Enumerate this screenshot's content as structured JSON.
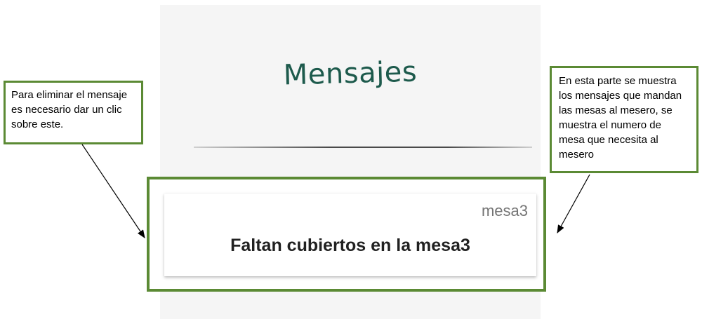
{
  "screen": {
    "title": "Mensajes"
  },
  "message_card": {
    "table": "mesa3",
    "text": "Faltan cubiertos en la mesa3"
  },
  "annotations": {
    "left": "Para eliminar el mensaje es necesario dar un clic sobre este.",
    "right": "En esta parte se muestra los mensajes que mandan las mesas al mesero, se muestra el numero de mesa que necesita al mesero"
  },
  "colors": {
    "title": "#1d5a4c",
    "annotation_border": "#5b8a34"
  }
}
